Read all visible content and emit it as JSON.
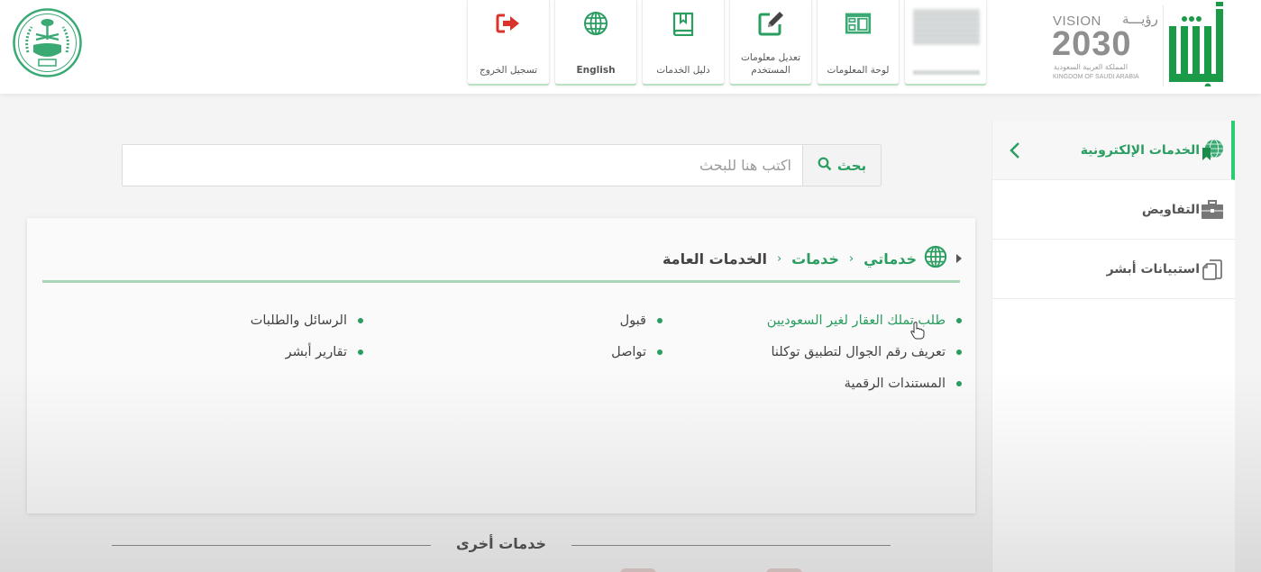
{
  "header": {
    "vision_logo": {
      "title_en": "VISION",
      "title_ar": "رؤيـــة",
      "year": "2030",
      "kingdom_ar": "المملكة العربية السعودية",
      "kingdom_en": "KINGDOM OF SAUDI ARABIA"
    },
    "absher_logo": "absher-logo",
    "emblem": "ministry-of-interior-emblem",
    "nav_tiles": [
      {
        "label": "تسجيل الخروج",
        "icon": "sign-out-icon",
        "color": "#d9342b"
      },
      {
        "label": "English",
        "icon": "globe-icon",
        "color": "#2a9d60"
      },
      {
        "label": "دليل الخدمات",
        "icon": "book-icon",
        "color": "#2a9d60"
      },
      {
        "label": "تعديل معلومات المستخدم",
        "icon": "edit-icon",
        "color": "#2a9d60"
      },
      {
        "label": "لوحة المعلومات",
        "icon": "dashboard-icon",
        "color": "#2a9d60"
      },
      {
        "label": "",
        "icon": "blurred-profile",
        "color": "#cccccc"
      }
    ]
  },
  "sidebar": {
    "items": [
      {
        "label": "الخدمات الإلكترونية",
        "icon": "eservices-globe-icon",
        "active": true
      },
      {
        "label": "التفاويض",
        "icon": "briefcase-icon",
        "active": false
      },
      {
        "label": "استبيانات أبشر",
        "icon": "documents-icon",
        "active": false
      }
    ]
  },
  "search": {
    "placeholder": "اكتب هنا للبحث",
    "value": "",
    "button_label": "بحث"
  },
  "breadcrumb": {
    "items": [
      "خدماتي",
      "خدمات"
    ],
    "current": "الخدمات العامة"
  },
  "services": {
    "column1": [
      "طلب تملك العقار لغير السعوديين",
      "تعريف رقم الجوال لتطبيق توكلنا",
      "المستندات الرقمية"
    ],
    "column2": [
      "قبول",
      "تواصل"
    ],
    "column3": [
      "الرسائل والطلبات",
      "تقارير أبشر"
    ]
  },
  "other_services": {
    "title": "خدمات أخرى"
  },
  "colors": {
    "brand_green": "#2a9d60",
    "accent_green": "#2ecc71",
    "logout_red": "#d9342b"
  }
}
